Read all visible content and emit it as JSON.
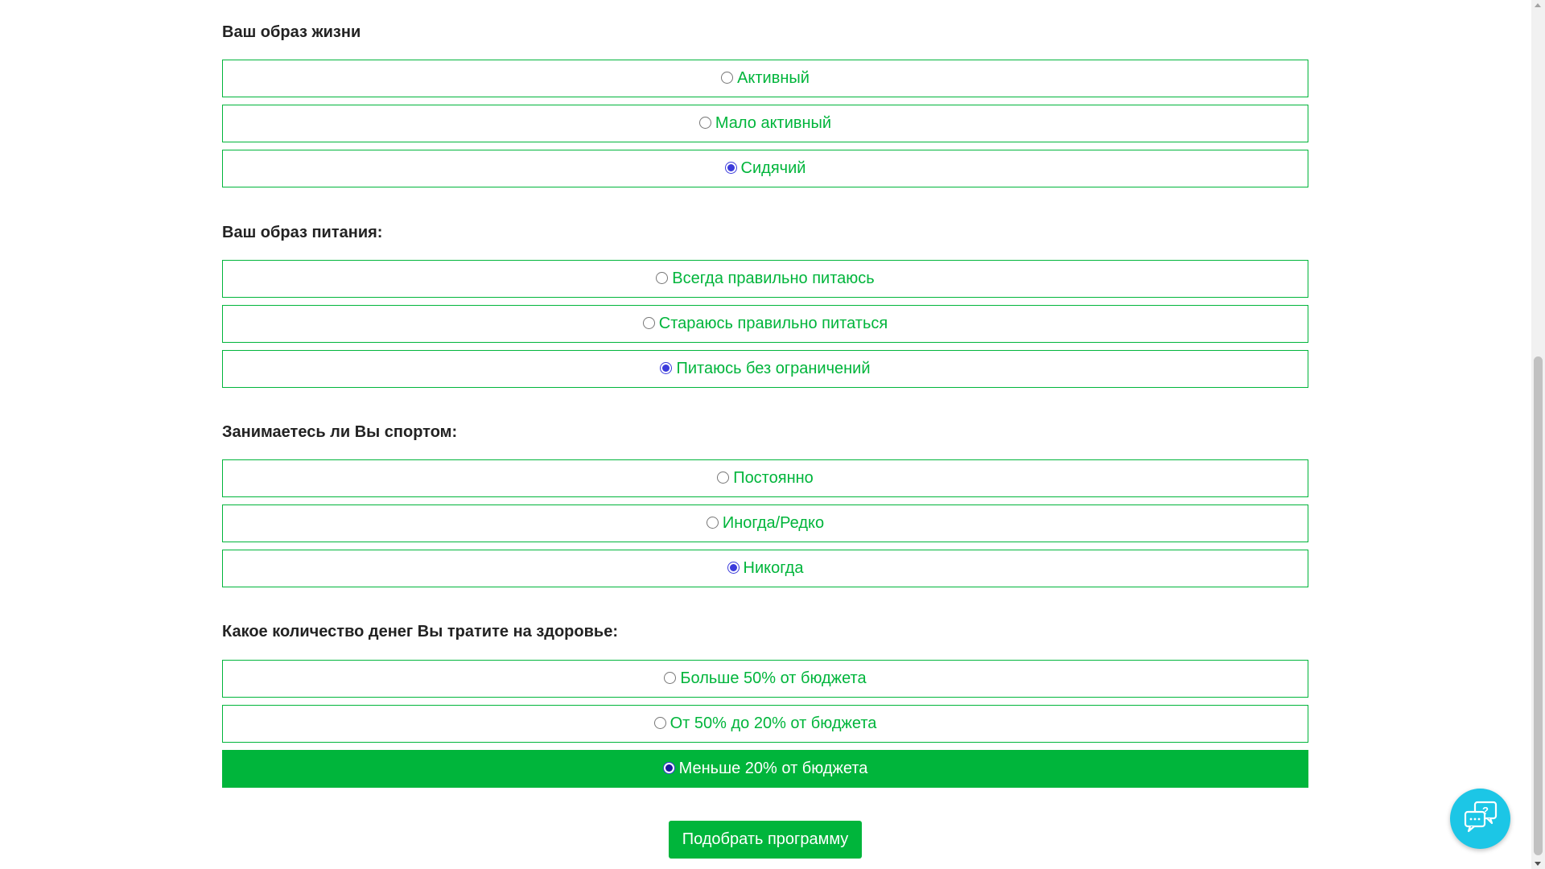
{
  "form": {
    "sections": [
      {
        "question": "Ваш образ жизни",
        "options": [
          {
            "label": "Активный",
            "checked": false,
            "highlighted": false
          },
          {
            "label": "Мало активный",
            "checked": false,
            "highlighted": false
          },
          {
            "label": "Сидячий",
            "checked": true,
            "highlighted": false
          }
        ]
      },
      {
        "question": "Ваш образ питания:",
        "options": [
          {
            "label": "Всегда правильно питаюсь",
            "checked": false,
            "highlighted": false
          },
          {
            "label": "Стараюсь правильно питаться",
            "checked": false,
            "highlighted": false
          },
          {
            "label": "Питаюсь без ограничений",
            "checked": true,
            "highlighted": false
          }
        ]
      },
      {
        "question": "Занимаетесь ли Вы спортом:",
        "options": [
          {
            "label": "Постоянно",
            "checked": false,
            "highlighted": false
          },
          {
            "label": "Иногда/Редко",
            "checked": false,
            "highlighted": false
          },
          {
            "label": "Никогда",
            "checked": true,
            "highlighted": false
          }
        ]
      },
      {
        "question": "Какое количество денег Вы тратите на здоровье:",
        "options": [
          {
            "label": "Больше 50% от бюджета",
            "checked": false,
            "highlighted": false
          },
          {
            "label": "От 50% до 20% от бюджета",
            "checked": false,
            "highlighted": false
          },
          {
            "label": "Меньше 20% от бюджета",
            "checked": true,
            "highlighted": true
          }
        ]
      }
    ],
    "submit_label": "Подобрать программу"
  },
  "help_widget": {
    "icon": "chat-question-icon"
  },
  "colors": {
    "accent": "#00b53b",
    "help_widget": "#1cc6e6",
    "radio_checked": "#3b3bdb",
    "question_text": "#222222"
  }
}
